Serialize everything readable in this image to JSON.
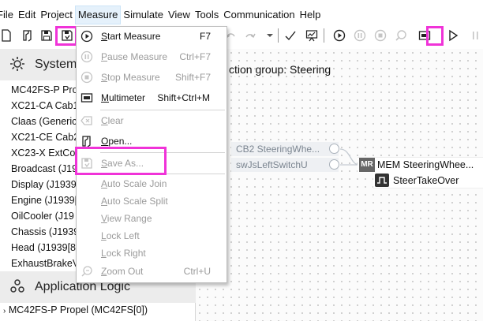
{
  "menubar": {
    "items": [
      {
        "label": "File",
        "active": false
      },
      {
        "label": "Edit",
        "active": false
      },
      {
        "label": "Project",
        "active": false
      },
      {
        "label": "Measure",
        "active": true
      },
      {
        "label": "Simulate",
        "active": false
      },
      {
        "label": "View",
        "active": false
      },
      {
        "label": "Tools",
        "active": false
      },
      {
        "label": "Communication",
        "active": false
      },
      {
        "label": "Help",
        "active": false
      }
    ]
  },
  "toolbar": {
    "icons": [
      "new-file-icon",
      "open-file-icon",
      "save-icon",
      "save-measurement-icon",
      "undo-icon",
      "redo-icon",
      "dropdown-arrow-icon",
      "checkmark-icon",
      "monitor-chart-icon",
      "start-measure-icon",
      "pause-measure-icon",
      "stop-measure-icon",
      "zoom-icon",
      "multimeter-icon",
      "play-icon",
      "pause-icon"
    ]
  },
  "left_panel": {
    "system_header": "System",
    "devices": [
      "MC42FS-P Pro",
      "XC21-CA Cab1",
      "Claas (Generic",
      "XC21-CE Cab2",
      "XC23-X ExtCo",
      "Broadcast (J19",
      "Display (J1939",
      "Engine (J1939[",
      "OilCooler (J19",
      "Chassis (J1939",
      "Head (J1939[8",
      "ExhaustBrakeV"
    ],
    "app_logic_header": "Application Logic",
    "app_logic_items": [
      "MC42FS-P Propel (MC42FS[0])"
    ]
  },
  "canvas": {
    "title": "ction group: Steering",
    "inputs": [
      "CB2 SteeringWhe...",
      "swJsLeftSwitchU"
    ],
    "mem_node": {
      "badge": "MR",
      "label": "MEM SteeringWhee..."
    },
    "signal_node": {
      "label": "SteerTakeOver"
    }
  },
  "measure_menu": {
    "items": [
      {
        "icon": "start-measure-icon",
        "mnemonic": "S",
        "rest": "tart Measure",
        "shortcut": "F7",
        "enabled": true
      },
      {
        "icon": "pause-measure-icon",
        "mnemonic": "P",
        "rest": "ause Measure",
        "shortcut": "Ctrl+F7",
        "enabled": false
      },
      {
        "icon": "stop-measure-icon",
        "mnemonic": "S",
        "rest": "top Measure",
        "shortcut": "Shift+F7",
        "enabled": false
      },
      {
        "icon": "multimeter-icon",
        "mnemonic": "M",
        "rest": "ultimeter",
        "shortcut": "Shift+Ctrl+M",
        "enabled": true
      },
      {
        "icon": "clear-icon",
        "mnemonic": "C",
        "rest": "lear",
        "shortcut": "",
        "enabled": false
      },
      {
        "icon": "open-icon",
        "mnemonic": "O",
        "rest": "pen...",
        "shortcut": "",
        "enabled": true
      },
      {
        "icon": "save-as-icon",
        "mnemonic": "S",
        "rest": "ave As...",
        "shortcut": "",
        "enabled": false
      },
      {
        "icon": "",
        "mnemonic": "A",
        "rest": "uto Scale Join",
        "shortcut": "",
        "enabled": false
      },
      {
        "icon": "",
        "mnemonic": "A",
        "rest": "uto Scale Split",
        "shortcut": "",
        "enabled": false
      },
      {
        "icon": "",
        "mnemonic": "V",
        "rest": "iew Range",
        "shortcut": "",
        "enabled": false
      },
      {
        "icon": "",
        "mnemonic": "L",
        "rest": "ock Left",
        "shortcut": "",
        "enabled": false
      },
      {
        "icon": "",
        "mnemonic": "L",
        "rest": "ock Right",
        "shortcut": "",
        "enabled": false
      },
      {
        "icon": "zoom-out-icon",
        "mnemonic": "Z",
        "rest": "oom Out",
        "shortcut": "Ctrl+U",
        "enabled": false
      }
    ]
  },
  "colors": {
    "highlight": "#f033d8",
    "disabled_text": "#9b9b9b",
    "menu_active_bg": "#e5f1fb",
    "section_header_bg": "#ececec"
  }
}
